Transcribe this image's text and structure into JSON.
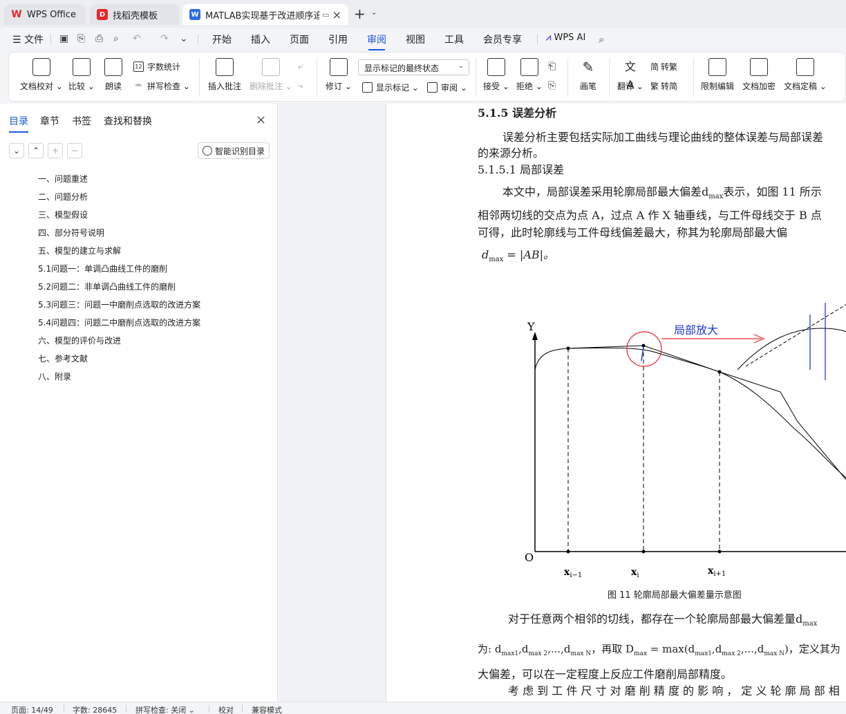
{
  "tabs": [
    {
      "label": "WPS Office",
      "icon": "wps-logo-icon"
    },
    {
      "label": "找稻壳模板",
      "icon": "docer-icon"
    },
    {
      "label": "MATLAB实现基于改进顺序追踪…",
      "icon": "word-doc-icon",
      "active": true
    }
  ],
  "menu": {
    "file": "文件",
    "items": [
      "开始",
      "插入",
      "页面",
      "引用",
      "审阅",
      "视图",
      "工具",
      "会员专享"
    ],
    "active": "审阅",
    "ai": "WPS AI"
  },
  "ribbon": {
    "doc_check": "文档校对",
    "compare": "比较",
    "read_aloud": "朗读",
    "word_count": "字数统计",
    "spell_check": "拼写检查",
    "insert_comment": "插入批注",
    "delete_comment": "删除批注",
    "revise": "修订",
    "markup_select": "显示标记的最终状态",
    "show_markup": "显示标记",
    "review": "审阅",
    "accept": "接受",
    "reject": "拒绝",
    "pen": "画笔",
    "translate": "翻译",
    "to_traditional": "转繁",
    "to_simplified": "转简",
    "restrict_edit": "限制编辑",
    "encrypt": "文档加密",
    "finalize": "文档定稿"
  },
  "panel": {
    "tabs": [
      "目录",
      "章节",
      "书签",
      "查找和替换"
    ],
    "active_tab": "目录",
    "smart_btn": "智能识别目录",
    "toc": [
      "一、问题重述",
      "二、问题分析",
      "三、模型假设",
      "四、部分符号说明",
      "五、模型的建立与求解",
      "5.1问题一：单调凸曲线工件的磨削",
      "5.2问题二：非单调凸曲线工件的磨削",
      "5.3问题三：问题一中磨削点选取的改进方案",
      "5.4问题四：问题二中磨削点选取的改进方案",
      "六、模型的评价与改进",
      "七、参考文献",
      "八、附录"
    ]
  },
  "doc": {
    "heading1": "5.1.5  误差分析",
    "p1_line1": "误差分析主要包括实际加工曲线与理论曲线的整体误差与局部误差",
    "p1_line2": "的来源分析。",
    "heading2": "5.1.5.1    局部误差",
    "p2_line1": "本文中，局部误差采用轮廓局部最大偏差d",
    "p2_sub": "max",
    "p2_line1b": "表示，如图  11 所示",
    "p2_line2": "相邻两切线的交点为点 A，过点 A 作 X 轴垂线，与工件母线交于 B 点",
    "p2_line3": "可得，此时轮廓线与工件母线偏差最大，称其为轮廓局部最大偏",
    "formula1": "d",
    "formula1_sub": "max",
    "formula1_rest": " = |AB|。",
    "fig_y": "Y",
    "fig_o": "O",
    "fig_label": "局部放大",
    "fig_x1": "x",
    "fig_x1_sub": "i−1",
    "fig_x2": "x",
    "fig_x2_sub": "i",
    "fig_x3": "x",
    "fig_x3_sub": "i+1",
    "caption": "图 11   轮廓局部最大偏差量示意图",
    "p3_line1": "对于任意两个相邻的切线，都存在一个轮廓局部最大偏差量d",
    "p3_sub": "max",
    "p3_line2": "为:   d",
    "p3_line2b": "max1",
    "p3_line2c": ",d",
    "p3_line2d": "max 2",
    "p3_line2e": ",...,d",
    "p3_line2f": "max N",
    "p3_line2g": "，再取 D",
    "p3_line2h": "max",
    "p3_line2i": " = max(d",
    "p3_line2j": "max1",
    "p3_line2k": ",d",
    "p3_line2l": "max 2",
    "p3_line2m": ",...,d",
    "p3_line2n": "max N",
    "p3_line2o": ")，定义其为",
    "p3_line3": "大偏差，可以在一定程度上反应工件磨削局部精度。",
    "p4_line1": "考 虑 到 工 件 尺 寸 对 磨 削 精 度 的 影 响 ，  定 义 轮 廓 局 部 相"
  },
  "status": {
    "page": "页面: 14/49",
    "words": "字数: 28645",
    "spell": "拼写检查: 关闭",
    "proof": "校对",
    "compat": "兼容模式"
  },
  "colors": {
    "accent": "#1a56db",
    "fig_red": "#e8262a",
    "fig_blue": "#1f37d6"
  }
}
